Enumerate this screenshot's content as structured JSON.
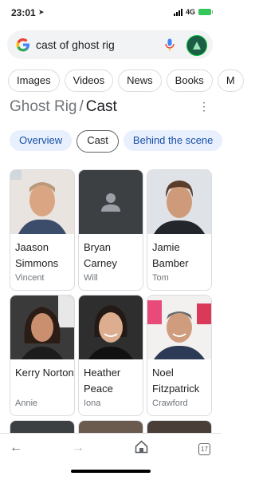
{
  "status": {
    "time": "23:01",
    "network": "4G"
  },
  "search": {
    "query": "cast of ghost rig"
  },
  "chips": [
    "Images",
    "Videos",
    "News",
    "Books",
    "M"
  ],
  "header": {
    "title": "Ghost Rig",
    "separator": "/",
    "current": "Cast"
  },
  "tabs": [
    "Overview",
    "Cast",
    "Behind the scene"
  ],
  "cast": [
    {
      "name": "Jaason Simmons",
      "role": "Vincent"
    },
    {
      "name": "Bryan Carney",
      "role": "Will"
    },
    {
      "name": "Jamie Bamber",
      "role": "Tom"
    },
    {
      "name": "Kerry Norton",
      "role": "Annie"
    },
    {
      "name": "Heather Peace",
      "role": "Iona"
    },
    {
      "name": "Noel Fitzpatrick",
      "role": "Crawford"
    }
  ],
  "bottom": {
    "tab_count": "17"
  },
  "colors": {
    "tab_bg": "#e8f0fe",
    "tab_text": "#174ea6",
    "mic_blue": "#4285f4"
  }
}
